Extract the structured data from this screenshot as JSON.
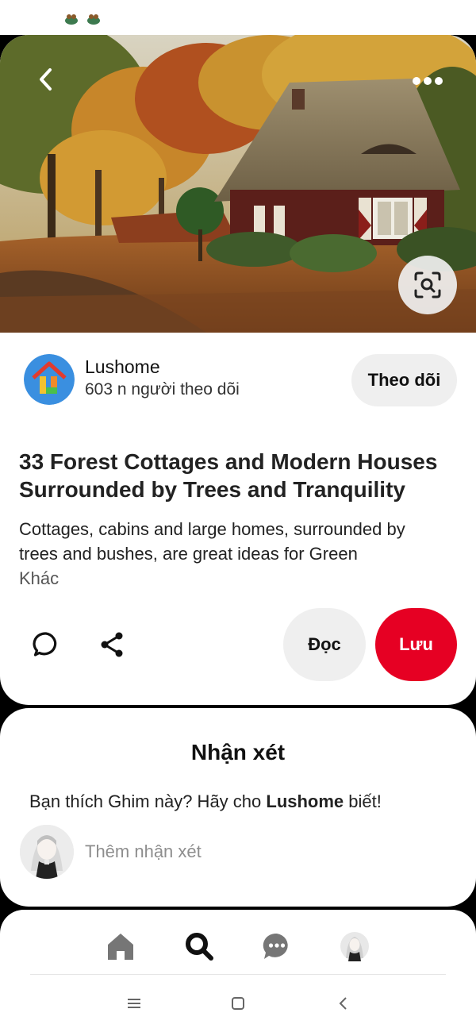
{
  "status_bar": {
    "icons": [
      "notification-icon-1",
      "notification-icon-2"
    ]
  },
  "hero": {
    "image_description": "cottage-in-autumn-forest",
    "icons": {
      "back": "chevron-left-icon",
      "more": "more-horizontal-icon",
      "lens": "visual-search-icon"
    }
  },
  "author": {
    "name": "Lushome",
    "followers": "603 n người theo dõi",
    "follow_label": "Theo dõi"
  },
  "pin": {
    "title": "33 Forest Cottages and Modern Houses Surrounded by Trees and Tranquility",
    "description": "Cottages, cabins and large homes, surrounded by trees and bushes, are great ideas for Green",
    "more_label": "Khác"
  },
  "actions": {
    "read_label": "Đọc",
    "save_label": "Lưu",
    "icons": [
      "comment-icon",
      "share-icon"
    ]
  },
  "comments": {
    "heading": "Nhận xét",
    "prompt_prefix": "Bạn thích Ghim này? Hãy cho ",
    "prompt_author": "Lushome",
    "prompt_suffix": " biết!",
    "input_placeholder": "Thêm nhận xét"
  },
  "bottom_nav": {
    "items": [
      "home-icon",
      "search-icon",
      "messages-icon",
      "profile-avatar"
    ]
  },
  "system_nav": {
    "items": [
      "recent-apps-icon",
      "home-button-icon",
      "back-icon"
    ]
  },
  "colors": {
    "accent": "#e60023",
    "button_bg": "#efefef",
    "text": "#111111"
  }
}
